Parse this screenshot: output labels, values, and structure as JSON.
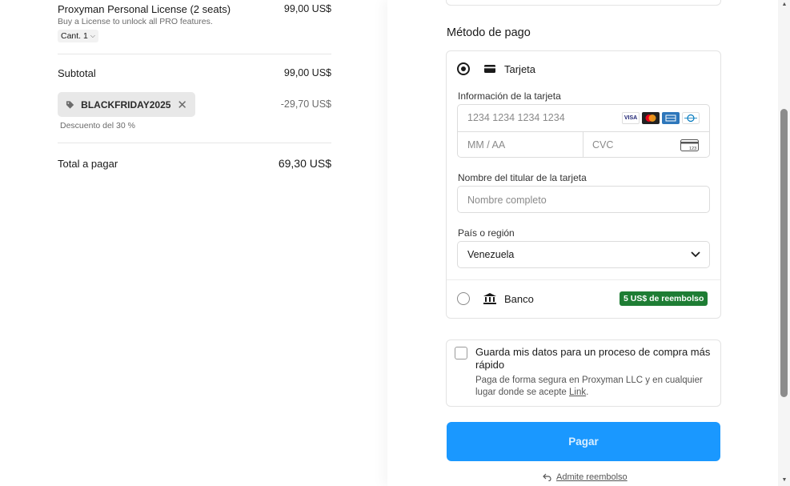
{
  "summary": {
    "product_name": "Proxyman Personal License (2 seats)",
    "product_price": "99,00 US$",
    "product_desc": "Buy a License to unlock all PRO features.",
    "qty_label": "Cant. 1",
    "subtotal_label": "Subtotal",
    "subtotal_value": "99,00 US$",
    "promo_code": "BLACKFRIDAY2025",
    "discount_value": "-29,70 US$",
    "discount_desc": "Descuento del 30 %",
    "total_label": "Total a pagar",
    "total_value": "69,30 US$"
  },
  "payment": {
    "section_title": "Método de pago",
    "card_method_label": "Tarjeta",
    "card_info_label": "Información de la tarjeta",
    "card_number_placeholder": "1234 1234 1234 1234",
    "expiry_placeholder": "MM / AA",
    "cvc_placeholder": "CVC",
    "card_brands": [
      "VISA",
      "mastercard",
      "amex",
      "diners"
    ],
    "holder_label": "Nombre del titular de la tarjeta",
    "holder_placeholder": "Nombre completo",
    "country_label": "País o región",
    "country_value": "Venezuela",
    "bank_method_label": "Banco",
    "bank_cashback": "5 US$ de reembolso",
    "selected_method": "Tarjeta"
  },
  "save_info": {
    "title": "Guarda mis datos para un proceso de compra más rápido",
    "desc_prefix": "Paga de forma segura en Proxyman LLC y en cualquier lugar donde se acepte ",
    "desc_link": "Link",
    "desc_suffix": ".",
    "checked": false
  },
  "actions": {
    "pay_label": "Pagar",
    "refund_label": "Admite reembolso"
  },
  "colors": {
    "pay_button": "#1a98ff",
    "cashback_badge": "#1e7d34",
    "promo_chip": "#e8e8e8"
  }
}
